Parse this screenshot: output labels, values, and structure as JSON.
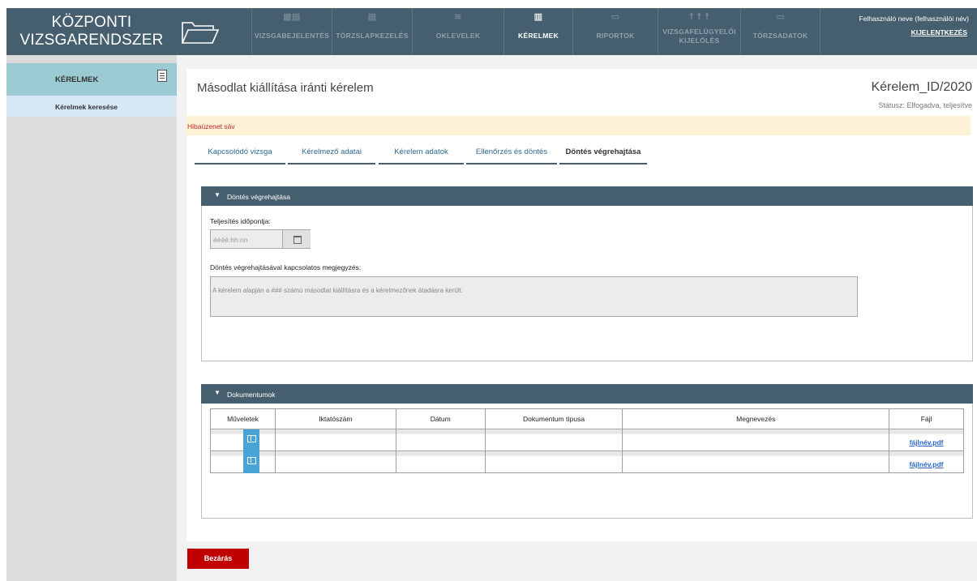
{
  "brand": {
    "line1": "KÖZPONTI",
    "line2": "VIZSGARENDSZER"
  },
  "nav": [
    {
      "label": "VIZSGABEJELENTÉS",
      "icon": "calendar-icon"
    },
    {
      "label": "TÖRZSLAPKEZELÉS",
      "icon": "document-icon"
    },
    {
      "label": "OKLEVELEK",
      "icon": "diploma-icon"
    },
    {
      "label": "KÉRELMEK",
      "icon": "request-icon",
      "active": true
    },
    {
      "label": "RIPORTOK",
      "icon": "report-icon"
    },
    {
      "label": "VIZSGAFELÜGYELŐI",
      "label2": "KIJELÖLÉS",
      "icon": "people-icon"
    },
    {
      "label": "TÖRZSADATOK",
      "icon": "monitor-icon"
    }
  ],
  "user": {
    "name": "Felhasználó neve (felhasználói név)",
    "logout": "KIJELENTKEZÉS"
  },
  "sidebar": {
    "header": "KÉRELMEK",
    "items": [
      {
        "label": "Kérelmek keresése"
      }
    ]
  },
  "page": {
    "title": "Másodlat kiállítása iránti kérelem",
    "request_id": "Kérelem_ID/2020",
    "status": "Státusz: Elfogadva, teljesítve",
    "error_bar": "Hibaüzenet sáv"
  },
  "tabs": [
    {
      "label": "Kapcsolódó vizsga"
    },
    {
      "label": "Kérelmező adatai"
    },
    {
      "label": "Kérelem adatok"
    },
    {
      "label": "Ellenőrzés és döntés"
    },
    {
      "label": "Döntés végrehajtása",
      "active": true
    }
  ],
  "execution": {
    "header": "Döntés végrehajtása",
    "date_label": "Teljesítés időpontja:",
    "date_placeholder": "éééé:hh:nn",
    "note_label": "Döntés végrehajtásával kapcsolatos megjegyzés:",
    "note_value": "A kérelem alapján a ### számú másodlat kiállításra és a kérelmezőnek átadásra került."
  },
  "documents": {
    "header": "Dokumentumok",
    "columns": [
      "Műveletek",
      "Iktatószám",
      "Dátum",
      "Dokumentum típusa",
      "Megnevezés",
      "Fájl"
    ],
    "rows": [
      {
        "file": "fájlnév.pdf"
      },
      {
        "file": "fájlnév.pdf"
      }
    ]
  },
  "close_button": "Bezárás",
  "colors": {
    "header_bg": "#455f6e",
    "sidebar_accent": "#9bcad3",
    "error_bg": "#fdf1d6",
    "close_button": "#c00000",
    "link": "#2a66c9"
  }
}
